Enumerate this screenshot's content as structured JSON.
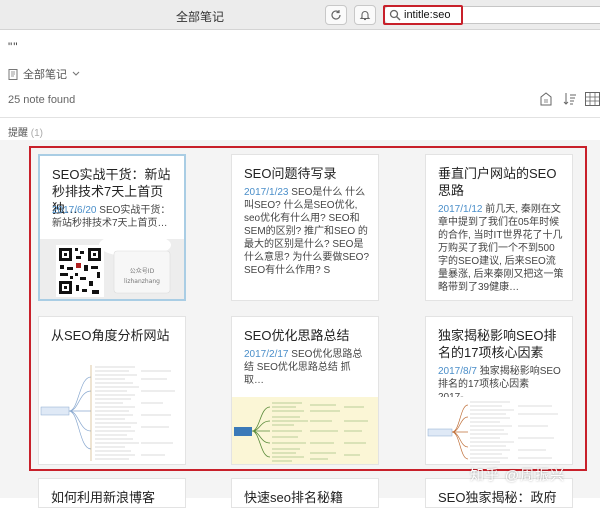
{
  "window": {
    "title": "全部笔记"
  },
  "toolbar": {
    "sync_icon": "refresh-icon",
    "notify_icon": "bell-icon"
  },
  "search": {
    "value": "intitle:seo",
    "icon": "search-icon"
  },
  "quote_mark": "\"\"",
  "notebook": {
    "label": "全部笔记",
    "icon": "notebook-icon",
    "chevron": "chevron-down-icon"
  },
  "note_count": "25 note found",
  "view_icons": [
    "shortcut-icon",
    "sort-icon",
    "grid-view-icon"
  ],
  "section": {
    "label": "提醒",
    "count": "(1)"
  },
  "colors": {
    "accent_red": "#c8202a",
    "date_blue": "#4a8ec9",
    "selected_border": "#a9cde4"
  },
  "notes": [
    {
      "title": "SEO实战干货：新站秒排技术7天上首页独…",
      "date": "2017/6/20",
      "snippet": "SEO实战干货：新站秒排技术7天上首页…",
      "thumb": "qrcode"
    },
    {
      "title": "SEO问题待写录",
      "date": "2017/1/23",
      "snippet": "SEO是什么 什么叫SEO? 什么是SEO优化, seo优化有什么用? SEO和SEM的区别? 推广和SEO 的最大的区别是什么? SEO是什么意思? 为什么要做SEO? SEO有什么作用? S"
    },
    {
      "title": "垂直门户网站的SEO思路",
      "date": "2017/1/12",
      "snippet": "前几天, 秦刚在文章中提到了我们在05年时候的合作, 当时IT世界花了十几万购买了我们一个不到500字的SEO建议, 后来SEO流量暴涨, 后来秦刚又把这一策略带到了39健康…"
    },
    {
      "title": "从SEO角度分析网站",
      "thumb": "mindmap"
    },
    {
      "title": "SEO优化思路总结",
      "date": "2017/2/17",
      "snippet": "SEO优化思路总结 SEO优化思路总结 抓取…",
      "thumb": "mindmap-yellow"
    },
    {
      "title": "独家揭秘影响SEO排名的17项核心因素",
      "date": "2017/8/7",
      "snippet": "独家揭秘影响SEO排名的17项核心因素 2017-…",
      "thumb": "mindmap"
    },
    {
      "title": "如何利用新浪博客SEO"
    },
    {
      "title": "快速seo排名秘籍"
    },
    {
      "title": "SEO独家揭秘：政府高"
    }
  ],
  "qrcode_caption": "公众号ID",
  "qrcode_id": "lizhanzhang",
  "watermark": "知乎 @周振兴"
}
